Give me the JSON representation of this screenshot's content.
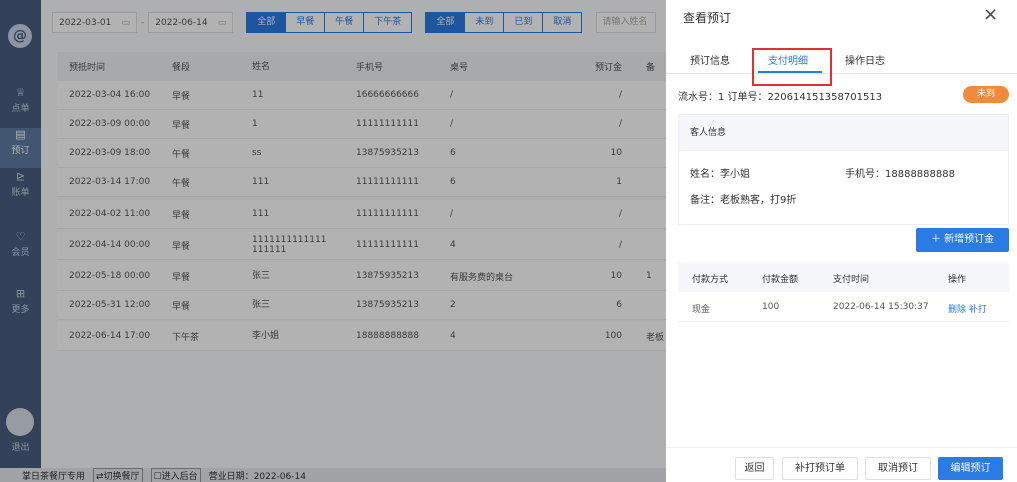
{
  "sidebar": {
    "logo": "@",
    "items": [
      {
        "label": "点单",
        "icon": "♕"
      },
      {
        "label": "预订",
        "icon": "▤"
      },
      {
        "label": "账单",
        "icon": "⊵"
      },
      {
        "label": "会员",
        "icon": "♡"
      },
      {
        "label": "更多",
        "icon": "⊞"
      }
    ],
    "logout": "退出"
  },
  "toolbar": {
    "date_start": "2022-03-01",
    "date_sep": "-",
    "date_end": "2022-06-14",
    "meal_filters": [
      "全部",
      "早餐",
      "午餐",
      "下午茶"
    ],
    "status_filters": [
      "全部",
      "未到",
      "已到",
      "取消"
    ],
    "search_placeholder": "请输入姓名"
  },
  "table": {
    "headers": [
      "预抵时间",
      "餐段",
      "姓名",
      "手机号",
      "桌号",
      "预订金",
      "备"
    ],
    "rows": [
      [
        "2022-03-04 16:00",
        "早餐",
        "11",
        "16666666666",
        "/",
        "/",
        ""
      ],
      [
        "2022-03-09 00:00",
        "早餐",
        "1",
        "11111111111",
        "/",
        "/",
        ""
      ],
      [
        "2022-03-09 18:00",
        "午餐",
        "ss",
        "13875935213",
        "6",
        "10",
        ""
      ],
      [
        "2022-03-14 17:00",
        "午餐",
        "111",
        "11111111111",
        "6",
        "1",
        ""
      ],
      [
        "2022-04-02 11:00",
        "早餐",
        "111",
        "11111111111",
        "/",
        "/",
        ""
      ],
      [
        "2022-04-14 00:00",
        "早餐",
        "1111111111111 111111",
        "11111111111",
        "4",
        "/",
        ""
      ],
      [
        "2022-05-18 00:00",
        "早餐",
        "张三",
        "13875935213",
        "有服务费的桌台",
        "10",
        "1"
      ],
      [
        "2022-05-31 12:00",
        "早餐",
        "张三",
        "13875935213",
        "2",
        "6",
        ""
      ],
      [
        "2022-06-14 17:00",
        "下午茶",
        "李小姐",
        "18888888888",
        "4",
        "100",
        "老板"
      ]
    ]
  },
  "footer": {
    "store": "掌日茶餐厅专用",
    "switch": "⇄切换餐厅",
    "enter_back": "☐进入后台",
    "business_date": "营业日期：2022-06-14"
  },
  "drawer": {
    "title": "查看预订",
    "close_icon": "×",
    "tabs": [
      "预订信息",
      "支付明细",
      "操作日志"
    ],
    "serial": "流水号：1   订单号：220614151358701513",
    "status_badge": "未到",
    "guest": {
      "section_title": "客人信息",
      "name": "姓名：李小姐",
      "phone": "手机号：18888888888",
      "note": "备注：老板熟客，打9折"
    },
    "add_deposit": "＋ 新增预订金",
    "payments": {
      "headers": [
        "付款方式",
        "付款金额",
        "支付时间",
        "操作"
      ],
      "rows": [
        {
          "method": "现金",
          "amount": "100",
          "time": "2022-06-14 15:30:37",
          "delete": "删除",
          "reprint": "补打"
        }
      ]
    },
    "actions": {
      "back": "返回",
      "reprint_order": "补打预订单",
      "cancel_order": "取消预订",
      "edit_order": "编辑预订"
    }
  }
}
